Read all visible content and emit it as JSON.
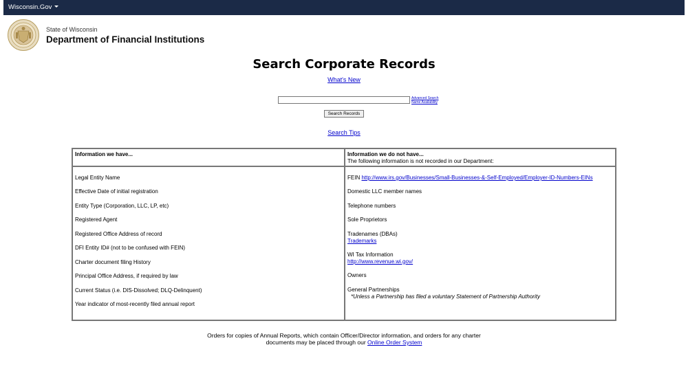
{
  "topbar": {
    "brand": "Wisconsin.Gov"
  },
  "header": {
    "state": "State of Wisconsin",
    "department": "Department of Financial Institutions"
  },
  "main": {
    "title": "Search Corporate Records",
    "whats_new": "What's New",
    "search": {
      "value": "",
      "placeholder": ""
    },
    "advanced_search": "Advanced Search",
    "name_availability": "Name Availability",
    "search_button": "Search Records",
    "search_tips": "Search Tips"
  },
  "table": {
    "have": {
      "header": "Information we have...",
      "items": [
        "Legal Entity Name",
        "Effective Date of initial registration",
        "Entity Type (Corporation, LLC, LP, etc)",
        "Registered Agent",
        "Registered Office Address of record",
        "DFI Entity ID# (not to be confused with FEIN)",
        "Charter document filing History",
        "Principal Office Address, if required by law",
        "Current Status (i.e. DIS-Dissolved; DLQ-Delinquent)",
        "Year indicator of most-recently filed annual report"
      ]
    },
    "have_not": {
      "header": "Information we do not have...",
      "subheader": "The following information is not recorded in our Department:",
      "fein_label": "FEIN",
      "fein_link": "http://www.irs.gov/Businesses/Small-Businesses-&-Self-Employed/Employer-ID-Numbers-EINs",
      "llc_members": "Domestic LLC member names",
      "telephone": "Telephone numbers",
      "sole_proprietors": "Sole Proprietors",
      "tradenames": "Tradenames (DBAs)",
      "trademarks_link": "Trademarks",
      "wi_tax": "WI Tax Information",
      "revenue_link": "http://www.revenue.wi.gov/",
      "owners": "Owners",
      "partnerships": "General Partnerships",
      "partnerships_note": "*Unless a Partnership has filed a voluntary Statement of Partnership Authority"
    }
  },
  "footer": {
    "line1": "Orders for copies of Annual Reports, which contain Officer/Director information, and orders for any charter",
    "line2_prefix": "documents may be placed through our ",
    "order_link": "Online Order System"
  },
  "colors": {
    "topbar": "#1b2a47",
    "link": "#0000cc",
    "table_border": "#777777"
  }
}
